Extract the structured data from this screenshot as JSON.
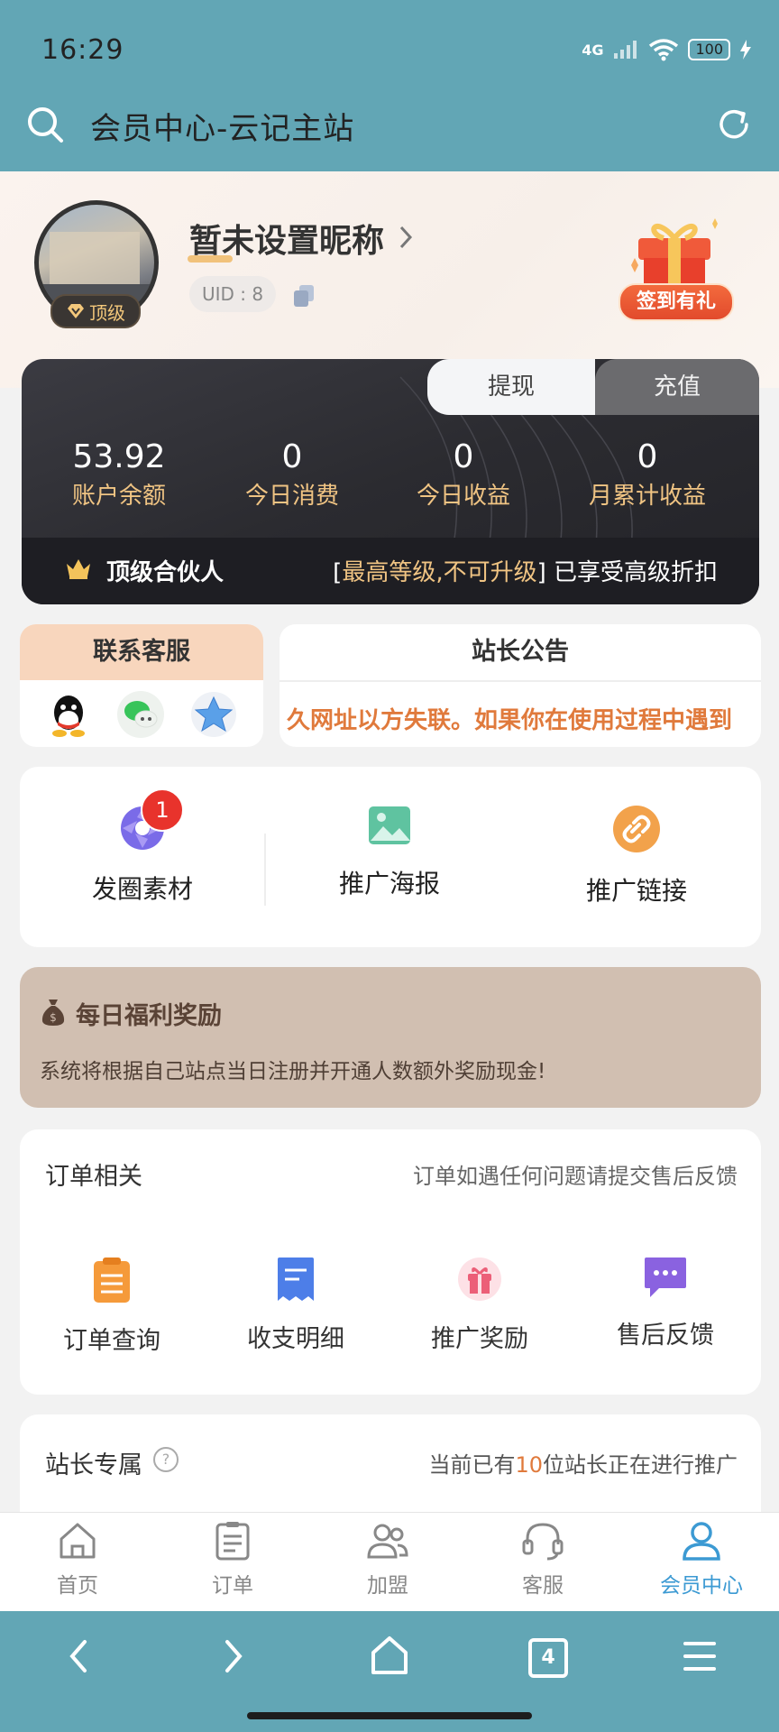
{
  "status_bar": {
    "time": "16:29",
    "network": "4G",
    "battery": "100"
  },
  "app_bar": {
    "title": "会员中心-云记主站"
  },
  "profile": {
    "nickname": "暂未设置昵称",
    "level_badge": "顶级",
    "uid": "UID : 8",
    "gift_label": "签到有礼"
  },
  "balance": {
    "tab_withdraw": "提现",
    "tab_recharge": "充值",
    "stats": [
      {
        "value": "53.92",
        "label": "账户余额"
      },
      {
        "value": "0",
        "label": "今日消费"
      },
      {
        "value": "0",
        "label": "今日收益"
      },
      {
        "value": "0",
        "label": "月累计收益"
      }
    ],
    "partner_title": "顶级合伙人",
    "partner_bracket_open": "[",
    "partner_highlight": "最高等级,不可升级",
    "partner_bracket_close": "]",
    "partner_suffix": " 已享受高级折扣"
  },
  "contact": {
    "title": "联系客服",
    "icons": [
      "qq-icon",
      "wechat-icon",
      "star-icon"
    ]
  },
  "notice": {
    "title": "站长公告",
    "text": "久网址以方失联。如果你在使用过程中遇到"
  },
  "tools": [
    {
      "label": "发圈素材",
      "badge": "1"
    },
    {
      "label": "推广海报"
    },
    {
      "label": "推广链接"
    }
  ],
  "reward": {
    "title": "每日福利奖励",
    "text": "系统将根据自己站点当日注册并开通人数额外奖励现金!"
  },
  "orders": {
    "title": "订单相关",
    "note": "订单如遇任何问题请提交售后反馈",
    "items": [
      {
        "label": "订单查询"
      },
      {
        "label": "收支明细"
      },
      {
        "label": "推广奖励"
      },
      {
        "label": "售后反馈"
      }
    ]
  },
  "station": {
    "title": "站长专属",
    "help": "?",
    "note_prefix": "当前已有",
    "note_count": "10",
    "note_suffix": "位站长正在进行推广"
  },
  "bottom_nav": [
    {
      "label": "首页",
      "active": false
    },
    {
      "label": "订单",
      "active": false
    },
    {
      "label": "加盟",
      "active": false
    },
    {
      "label": "客服",
      "active": false
    },
    {
      "label": "会员中心",
      "active": true
    }
  ],
  "system_nav": {
    "tab_count": "4"
  },
  "colors": {
    "header": "#62a6b5",
    "accent_gold": "#f0c483",
    "nav_active": "#3c9ad3",
    "notice_orange": "#e07a3c"
  }
}
